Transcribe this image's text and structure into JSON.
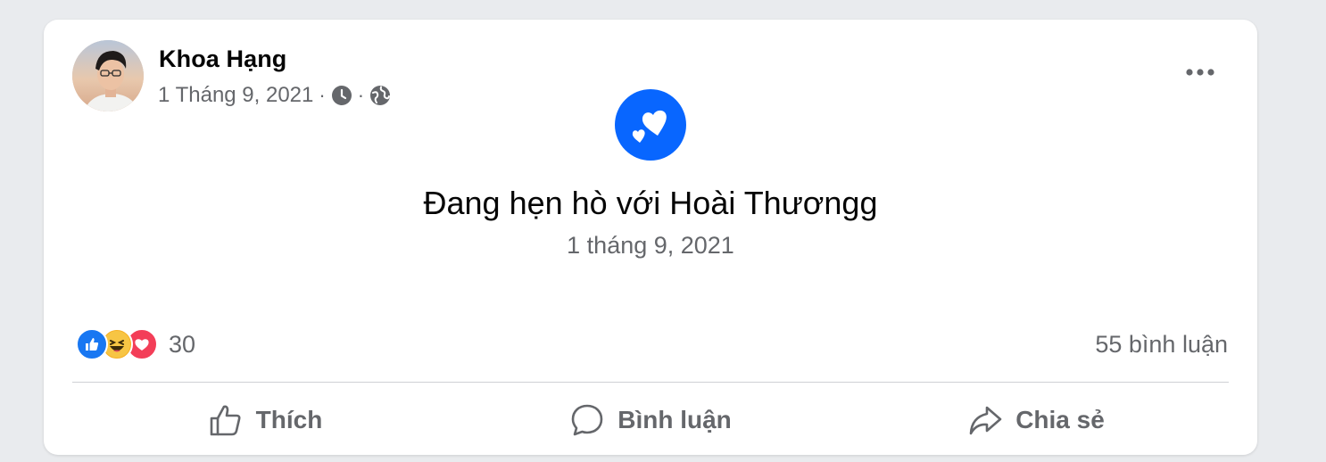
{
  "post": {
    "author": "Khoa Hạng",
    "date": "1 Tháng 9, 2021",
    "separator": "·",
    "clock_icon": "clock-icon",
    "privacy_icon": "globe-icon",
    "more_icon": "more-horizontal-icon"
  },
  "life_event": {
    "icon": "hearts-icon",
    "title": "Đang hẹn hò với Hoài Thươngg",
    "date": "1 tháng 9, 2021"
  },
  "stats": {
    "reaction_icons": [
      "like-reaction-icon",
      "haha-reaction-icon",
      "love-reaction-icon"
    ],
    "reactions_count": "30",
    "comments_label": "55 bình luận"
  },
  "actions": {
    "like_label": "Thích",
    "comment_label": "Bình luận",
    "share_label": "Chia sẻ"
  },
  "colors": {
    "brand_blue": "#0866ff",
    "secondary_text": "#65676b",
    "primary_text": "#050505",
    "love_red": "#f33e58",
    "haha_yellow": "#f7b125"
  }
}
